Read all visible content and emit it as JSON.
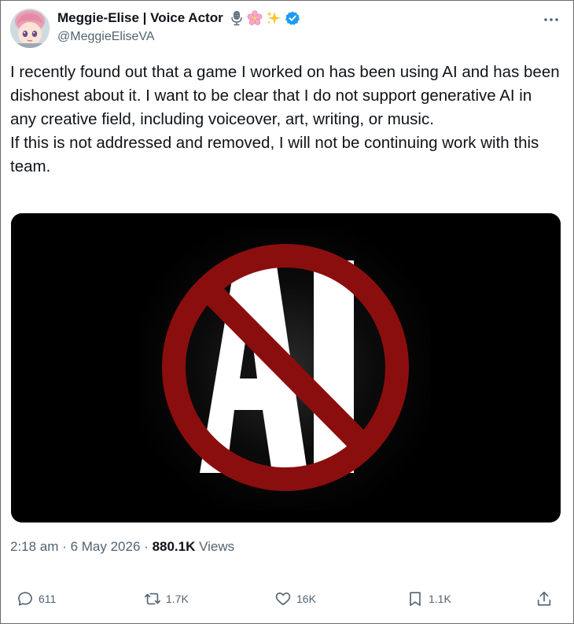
{
  "author": {
    "display_name": "Meggie-Elise | Voice Actor",
    "emoji_badges": [
      "microphone-icon",
      "cherry-blossom-icon",
      "sparkles-icon"
    ],
    "verified": true,
    "handle": "@MeggieEliseVA"
  },
  "post": {
    "paragraphs": [
      "I recently found out that a game I worked on has been using AI and has been dishonest about it. I want to be clear that I do not support generative AI in any creative field, including voiceover, art, writing, or music.",
      "If this is not addressed and removed, I will not be continuing work with this team."
    ],
    "image": {
      "text": "AI",
      "symbol": "prohibition-sign"
    }
  },
  "meta": {
    "time": "2:18 am",
    "separator": "·",
    "date": "6 May 2026",
    "views_count": "880.1K",
    "views_label": "Views"
  },
  "actions": {
    "replies": "611",
    "reposts": "1.7K",
    "likes": "16K",
    "bookmarks": "1.1K"
  },
  "colors": {
    "text": "#0f1419",
    "secondary": "#536471",
    "verified": "#1d9bf0",
    "prohibition_red": "#8b0e0e"
  }
}
